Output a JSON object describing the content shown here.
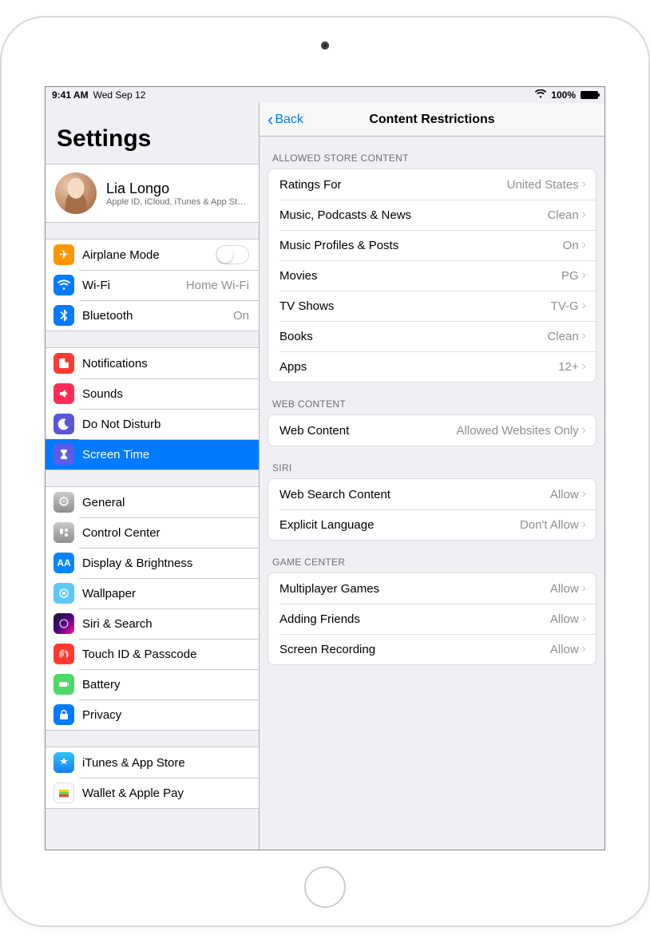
{
  "status": {
    "time": "9:41 AM",
    "date": "Wed Sep 12",
    "battery": "100%"
  },
  "sidebar": {
    "title": "Settings",
    "profile": {
      "name": "Lia Longo",
      "sub": "Apple ID, iCloud, iTunes & App St…"
    },
    "g1": {
      "airplane": "Airplane Mode",
      "wifi": "Wi-Fi",
      "wifi_val": "Home Wi-Fi",
      "bluetooth": "Bluetooth",
      "bluetooth_val": "On"
    },
    "g2": {
      "notifications": "Notifications",
      "sounds": "Sounds",
      "dnd": "Do Not Disturb",
      "screentime": "Screen Time"
    },
    "g3": {
      "general": "General",
      "control_center": "Control Center",
      "display": "Display & Brightness",
      "wallpaper": "Wallpaper",
      "siri": "Siri & Search",
      "touchid": "Touch ID & Passcode",
      "battery": "Battery",
      "privacy": "Privacy"
    },
    "g4": {
      "itunes": "iTunes & App Store",
      "wallet": "Wallet & Apple Pay"
    }
  },
  "detail": {
    "back": "Back",
    "title": "Content Restrictions",
    "sections": {
      "allowed": {
        "header": "Allowed Store Content",
        "ratings": {
          "label": "Ratings For",
          "value": "United States"
        },
        "music": {
          "label": "Music, Podcasts & News",
          "value": "Clean"
        },
        "profiles": {
          "label": "Music Profiles & Posts",
          "value": "On"
        },
        "movies": {
          "label": "Movies",
          "value": "PG"
        },
        "tv": {
          "label": "TV Shows",
          "value": "TV-G"
        },
        "books": {
          "label": "Books",
          "value": "Clean"
        },
        "apps": {
          "label": "Apps",
          "value": "12+"
        }
      },
      "web": {
        "header": "Web Content",
        "webcontent": {
          "label": "Web Content",
          "value": "Allowed Websites Only"
        }
      },
      "siri": {
        "header": "Siri",
        "search": {
          "label": "Web Search Content",
          "value": "Allow"
        },
        "explicit": {
          "label": "Explicit Language",
          "value": "Don't Allow"
        }
      },
      "gamecenter": {
        "header": "Game Center",
        "multiplayer": {
          "label": "Multiplayer Games",
          "value": "Allow"
        },
        "friends": {
          "label": "Adding Friends",
          "value": "Allow"
        },
        "recording": {
          "label": "Screen Recording",
          "value": "Allow"
        }
      }
    }
  }
}
